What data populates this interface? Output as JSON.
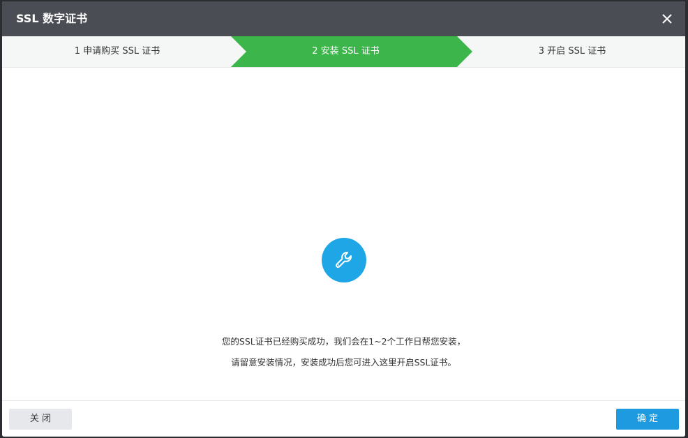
{
  "dialog": {
    "title": "SSL 数字证书",
    "close_icon": "close-icon"
  },
  "steps": [
    {
      "label": "1 申请购买 SSL 证书",
      "state": "done"
    },
    {
      "label": "2 安装 SSL 证书",
      "state": "active"
    },
    {
      "label": "3 开启 SSL 证书",
      "state": "pending"
    }
  ],
  "content": {
    "icon": "wrench-icon",
    "message_line1": "您的SSL证书已经购买成功，我们会在1~2个工作日帮您安装，",
    "message_line2": "请留意安装情况，安装成功后您可进入这里开启SSL证书。"
  },
  "footer": {
    "close_label": "关 闭",
    "confirm_label": "确 定"
  },
  "colors": {
    "active_step": "#3cb54a",
    "primary": "#1e9be0",
    "icon_circle": "#1ea6e6",
    "titlebar": "#4a4e54"
  }
}
